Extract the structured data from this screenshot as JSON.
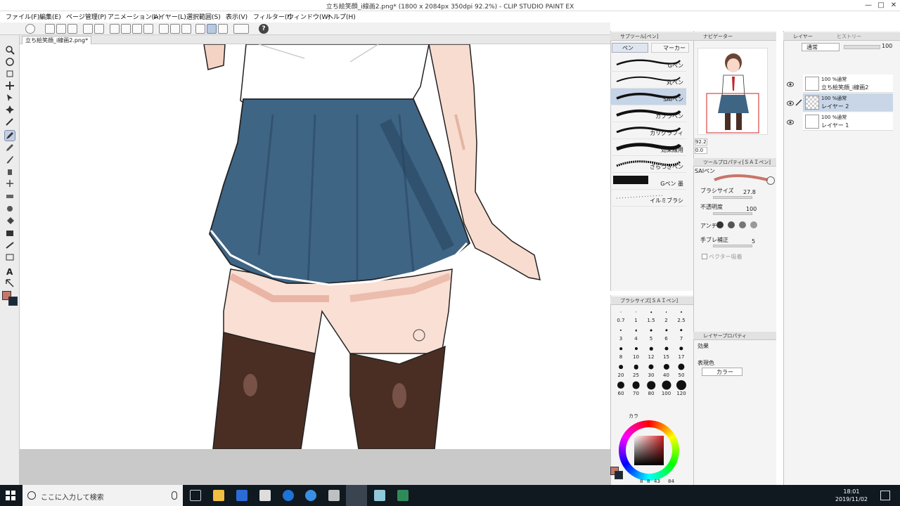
{
  "window": {
    "title": "立ち絵笑顔_i線画2.png* (1800 x 2084px 350dpi 92.2%) - CLIP STUDIO PAINT EX"
  },
  "menu": [
    "ファイル(F)",
    "編集(E)",
    "ページ管理(P)",
    "アニメーション(A)",
    "レイヤー(L)",
    "選択範囲(S)",
    "表示(V)",
    "フィルター(I)",
    "ウィンドウ(W)",
    "ヘルプ(H)"
  ],
  "toolbar": {
    "help_label": "?"
  },
  "document_tab": {
    "label": "立ち絵笑顔_i線画2.png*"
  },
  "subtool": {
    "panel_title": "サブツール[ペン]",
    "tabs": [
      "ペン",
      "マーカー"
    ],
    "items": [
      "Gペン",
      "丸ペン",
      "SAIペン",
      "カブラペン",
      "カリグラフィ",
      "効果線用",
      "ざらつきペン",
      "Gペン 墨",
      "イルミブラシ"
    ],
    "selected": "SAIペン"
  },
  "navigator": {
    "panel_title": "ナビゲーター",
    "zoom": "92.2",
    "rotate": "0.0"
  },
  "tool_property": {
    "panel_title": "ツールプロパティ[ＳＡＩペン]",
    "tool_name": "SAIペン",
    "brush_size_label": "ブラシサイズ",
    "brush_size_value": "27.8",
    "opacity_label": "不透明度",
    "opacity_value": "100",
    "antialias_label": "アンチ",
    "stabilization_label": "手ブレ補正",
    "stabilization_value": "5",
    "vector_label": "ベクター吸着"
  },
  "brush_size_panel": {
    "panel_title": "ブラシサイズ[ＳＡＩペン]",
    "sizes": [
      "0.7",
      "1",
      "1.5",
      "2",
      "2.5",
      "3",
      "4",
      "5",
      "6",
      "7",
      "8",
      "10",
      "12",
      "15",
      "17",
      "20",
      "25",
      "30",
      "40",
      "50",
      "60",
      "70",
      "80",
      "100",
      "120"
    ]
  },
  "color_panel": {
    "tab_label": "カラ",
    "bottom_numbers": [
      "8",
      "8",
      "43",
      "84"
    ]
  },
  "layer_property": {
    "panel_title": "レイヤープロパティ",
    "effect_label": "効果",
    "expression_label": "表現色",
    "expression_value": "カラー"
  },
  "layers": {
    "panel_title": "レイヤー",
    "history_tab": "ヒストリー",
    "blend_mode": "通常",
    "opacity": "100",
    "items": [
      {
        "mode": "100 %通常",
        "name": "立ち絵笑顔_i線画2"
      },
      {
        "mode": "100 %通常",
        "name": "レイヤー 2"
      },
      {
        "mode": "100 %通常",
        "name": "レイヤー 1"
      }
    ]
  },
  "taskbar": {
    "search_placeholder": "ここに入力して検索",
    "time": "18:01",
    "date": "2019/11/02"
  },
  "colors": {
    "main_color": "#c8756a",
    "sub_color": "#1a2a3a",
    "skirt": "#3f6585",
    "skin": "#f9dfd4",
    "stockings": "#4a2e24"
  }
}
